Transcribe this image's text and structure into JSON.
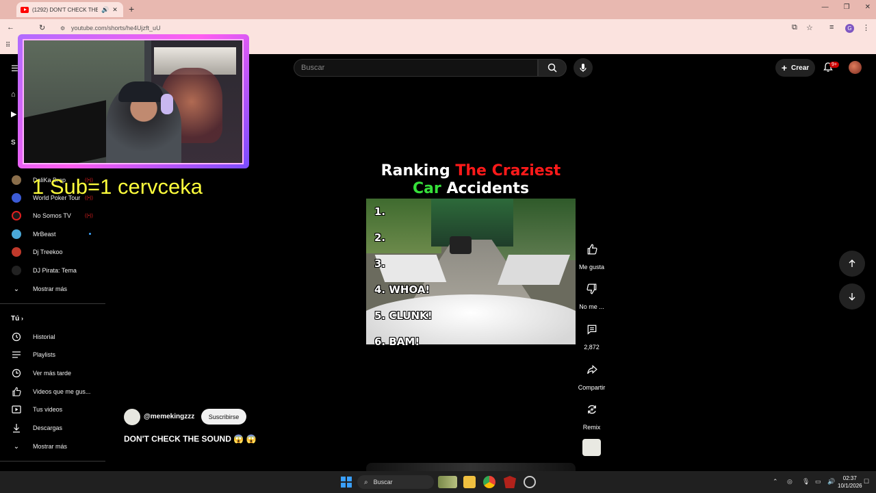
{
  "browser": {
    "tab_title": "(1292) DON'T CHECK THE S",
    "url": "youtube.com/shorts/he4Ujzft_uU",
    "new_tab": "+",
    "win_min": "—",
    "win_max": "❐",
    "win_close": "✕"
  },
  "youtube": {
    "search_placeholder": "Buscar",
    "create_label": "Crear",
    "notif_badge": "9+"
  },
  "sidebar": {
    "section_partial": "S",
    "subscriptions": [
      {
        "label": "DaliKa Brop",
        "live": true,
        "color": "#8a6e4b"
      },
      {
        "label": "World Poker Tour",
        "live": true,
        "color": "#3c5bd6"
      },
      {
        "label": "No Somos TV",
        "live": true,
        "color": "#e02020"
      },
      {
        "label": "MrBeast",
        "live": false,
        "new": true,
        "color": "#4aa8d8"
      },
      {
        "label": "Dj Treekoo",
        "live": false,
        "color": "#c0392b"
      },
      {
        "label": "DJ Pirata: Tema",
        "live": false,
        "color": "#222222"
      }
    ],
    "show_more_1": "Mostrar más",
    "you_heading": "Tú",
    "you_items": [
      {
        "label": "Historial",
        "icon": "history-icon"
      },
      {
        "label": "Playlists",
        "icon": "playlists-icon"
      },
      {
        "label": "Ver más tarde",
        "icon": "watch-later-icon"
      },
      {
        "label": "Videos que me gus...",
        "icon": "liked-videos-icon"
      },
      {
        "label": "Tus videos",
        "icon": "your-videos-icon"
      },
      {
        "label": "Descargas",
        "icon": "downloads-icon"
      }
    ],
    "show_more_2": "Mostrar más"
  },
  "stream_overlay": {
    "sub_text": "1 Sub=1 cervceka"
  },
  "short": {
    "headline_1a": "Ranking ",
    "headline_1b": "The Craziest",
    "headline_2a": "Car",
    "headline_2b": " Accidents",
    "ranks": [
      "1.",
      "2.",
      "3.",
      "4. WHOA!",
      "5. CLUNK!",
      "6. BAM!"
    ],
    "channel": "@memekingzzz",
    "subscribe": "Suscribirse",
    "title": "DON'T CHECK THE SOUND 😱 😱"
  },
  "actions": {
    "like": "Me gusta",
    "dislike": "No me ...",
    "comments": "2,872",
    "share": "Compartir",
    "remix": "Remix"
  },
  "taskbar": {
    "search": "Buscar",
    "time": "02:37",
    "date": "10/1/2026"
  }
}
